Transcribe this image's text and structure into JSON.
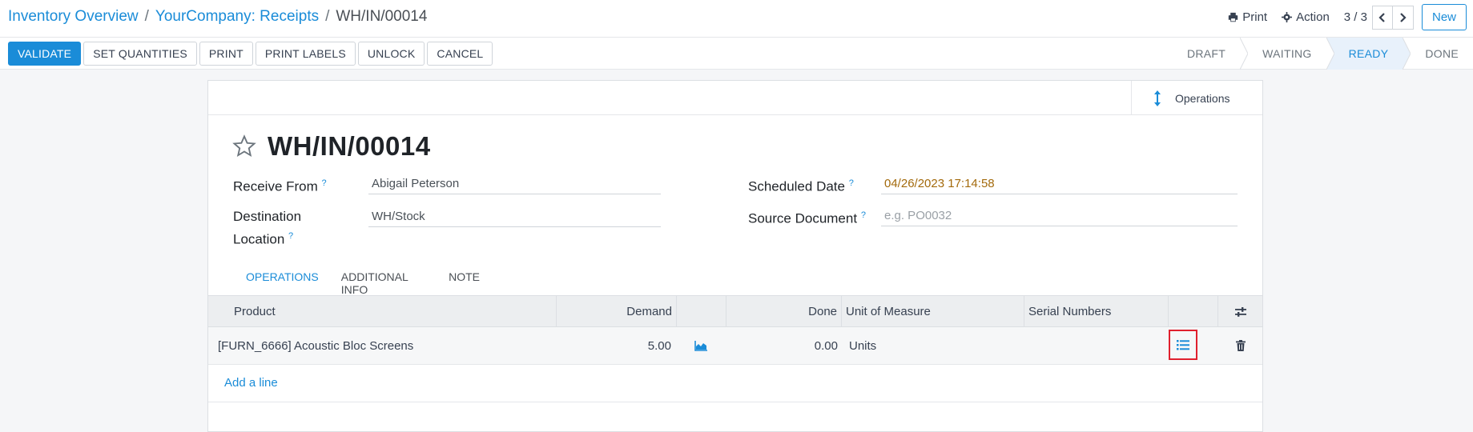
{
  "breadcrumb": {
    "items": [
      "Inventory Overview",
      "YourCompany: Receipts"
    ],
    "current": "WH/IN/00014"
  },
  "topbar": {
    "print_label": "Print",
    "action_label": "Action",
    "pager": "3 / 3",
    "new_label": "New"
  },
  "actions": {
    "validate": "VALIDATE",
    "set_quantities": "SET QUANTITIES",
    "print": "PRINT",
    "print_labels": "PRINT LABELS",
    "unlock": "UNLOCK",
    "cancel": "CANCEL"
  },
  "status": {
    "steps": [
      "DRAFT",
      "WAITING",
      "READY",
      "DONE"
    ],
    "active": "READY"
  },
  "smart_button": {
    "operations": "Operations"
  },
  "record": {
    "title": "WH/IN/00014",
    "fields": {
      "receive_from_label": "Receive From",
      "receive_from_value": "Abigail Peterson",
      "destination_label_line1": "Destination",
      "destination_label_line2": "Location",
      "destination_value": "WH/Stock",
      "scheduled_date_label": "Scheduled Date",
      "scheduled_date_value": "04/26/2023 17:14:58",
      "source_document_label": "Source Document",
      "source_document_placeholder": "e.g. PO0032"
    },
    "help_mark": "?"
  },
  "tabs": [
    "OPERATIONS",
    "ADDITIONAL INFO",
    "NOTE"
  ],
  "table": {
    "headers": {
      "product": "Product",
      "demand": "Demand",
      "done": "Done",
      "uom": "Unit of Measure",
      "serials": "Serial Numbers"
    },
    "rows": [
      {
        "product": "[FURN_6666] Acoustic Bloc Screens",
        "demand": "5.00",
        "done": "0.00",
        "uom": "Units",
        "serials": ""
      }
    ],
    "add_line": "Add a line"
  },
  "colors": {
    "accent": "#1a8cd8",
    "date": "#a36a0c",
    "highlight": "#e0202e"
  }
}
